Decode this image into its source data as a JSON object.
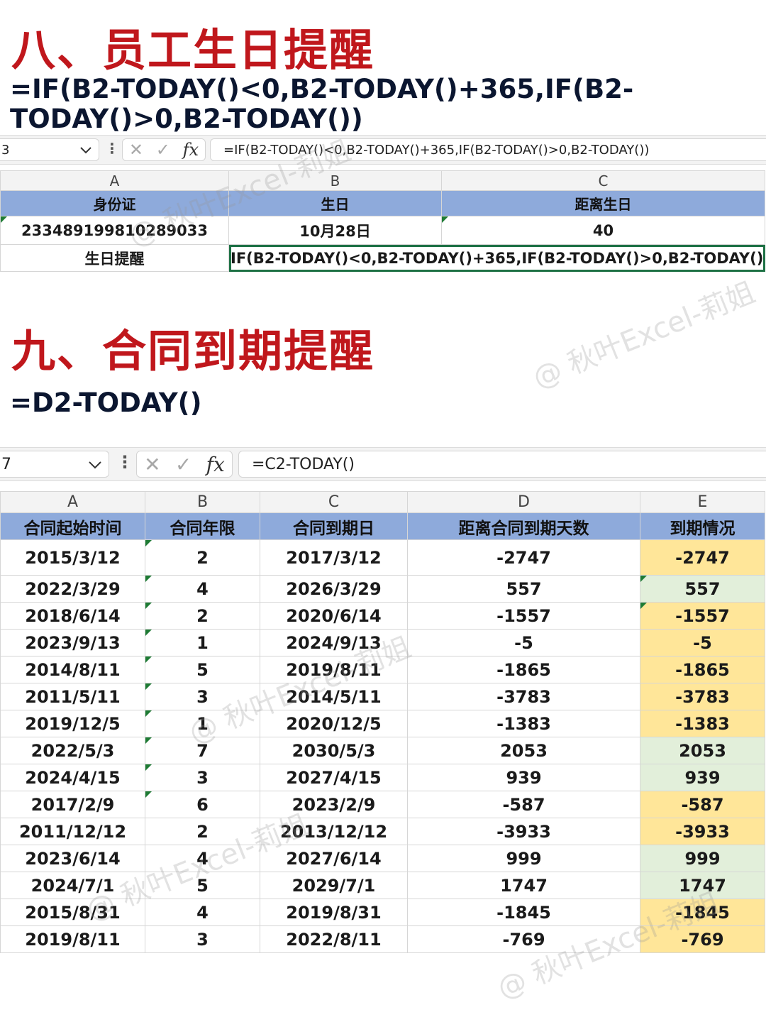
{
  "section8": {
    "title": "八、员工生日提醒",
    "formula_line1": "=IF(B2-TODAY()<0,B2-TODAY()+365,IF(B2-",
    "formula_line2": "TODAY()>0,B2-TODAY())",
    "name_box": "3",
    "formula_bar": "=IF(B2-TODAY()<0,B2-TODAY()+365,IF(B2-TODAY()>0,B2-TODAY())",
    "columns": [
      "A",
      "B",
      "C"
    ],
    "headers": [
      "身份证",
      "生日",
      "距离生日"
    ],
    "row1": [
      "233489199810289033",
      "10月28日",
      "40"
    ],
    "row2_label": "生日提醒",
    "row2_edit": "IF(B2-TODAY()<0,B2-TODAY()+365,IF(B2-TODAY()>0,B2-TODAY())"
  },
  "section9": {
    "title": "九、合同到期提醒",
    "formula": "=D2-TODAY()",
    "name_box": "7",
    "formula_bar": "=C2-TODAY()",
    "columns": [
      "A",
      "B",
      "C",
      "D",
      "E"
    ],
    "headers": [
      "合同起始时间",
      "合同年限",
      "合同到期日",
      "距离合同到期天数",
      "到期情况"
    ],
    "rows": [
      [
        "2015/3/12",
        "2",
        "2017/3/12",
        "-2747",
        "-2747"
      ],
      [
        "2022/3/29",
        "4",
        "2026/3/29",
        "557",
        "557"
      ],
      [
        "2018/6/14",
        "2",
        "2020/6/14",
        "-1557",
        "-1557"
      ],
      [
        "2023/9/13",
        "1",
        "2024/9/13",
        "-5",
        "-5"
      ],
      [
        "2014/8/11",
        "5",
        "2019/8/11",
        "-1865",
        "-1865"
      ],
      [
        "2011/5/11",
        "3",
        "2014/5/11",
        "-3783",
        "-3783"
      ],
      [
        "2019/12/5",
        "1",
        "2020/12/5",
        "-1383",
        "-1383"
      ],
      [
        "2022/5/3",
        "7",
        "2030/5/3",
        "2053",
        "2053"
      ],
      [
        "2024/4/15",
        "3",
        "2027/4/15",
        "939",
        "939"
      ],
      [
        "2017/2/9",
        "6",
        "2023/2/9",
        "-587",
        "-587"
      ],
      [
        "2011/12/12",
        "2",
        "2013/12/12",
        "-3933",
        "-3933"
      ],
      [
        "2023/6/14",
        "4",
        "2027/6/14",
        "999",
        "999"
      ],
      [
        "2024/7/1",
        "5",
        "2029/7/1",
        "1747",
        "1747"
      ],
      [
        "2015/8/31",
        "4",
        "2019/8/31",
        "-1845",
        "-1845"
      ],
      [
        "2019/8/11",
        "3",
        "2022/8/11",
        "-769",
        "-769"
      ]
    ]
  },
  "watermark": "@ 秋叶Excel-莉姐",
  "colors": {
    "title": "#c0171c",
    "formula_text": "#0b1630",
    "header_fill": "#8eaadb",
    "expired_fill": "#ffe699",
    "remaining_fill": "#e2efda",
    "selection_border": "#1e7145"
  }
}
